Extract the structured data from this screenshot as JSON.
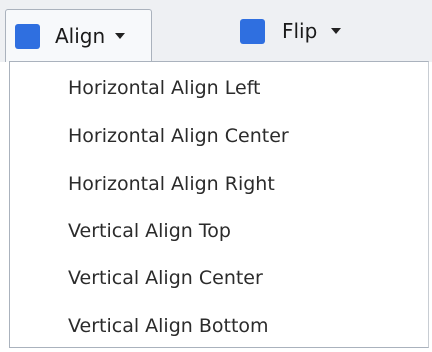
{
  "toolbar": {
    "align_button": {
      "label": "Align",
      "swatch_color": "#2f6fe0",
      "icon": "chevron-down-icon"
    },
    "flip_button": {
      "label": "Flip",
      "swatch_color": "#2f6fe0",
      "icon": "chevron-down-icon"
    }
  },
  "menu": {
    "items": [
      {
        "label": "Horizontal Align Left"
      },
      {
        "label": "Horizontal Align Center"
      },
      {
        "label": "Horizontal Align Right"
      },
      {
        "label": "Vertical Align Top"
      },
      {
        "label": "Vertical Align Center"
      },
      {
        "label": "Vertical Align Bottom"
      }
    ]
  }
}
